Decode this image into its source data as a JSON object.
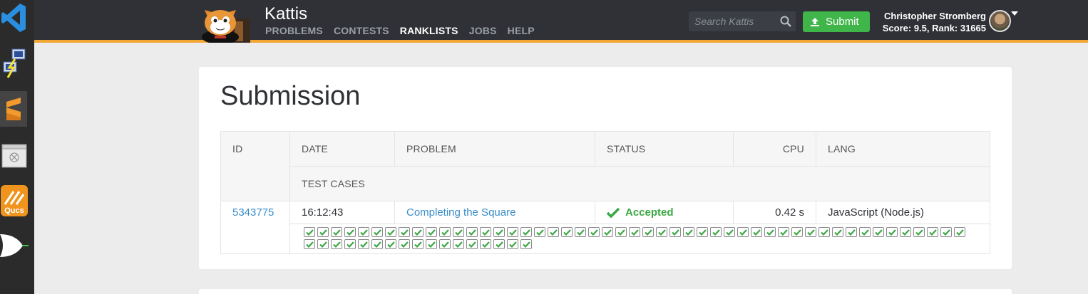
{
  "dock": {
    "icons": [
      "vscode-icon",
      "network-icon",
      "sublime-icon",
      "disk-icon",
      "qucs-icon",
      "logic-gate-icon"
    ],
    "qucs_label": "Qucs"
  },
  "navbar": {
    "brand": "Kattis",
    "links": [
      "PROBLEMS",
      "CONTESTS",
      "RANKLISTS",
      "JOBS",
      "HELP"
    ],
    "active_link": "RANKLISTS",
    "search_placeholder": "Search Kattis",
    "submit_label": "Submit",
    "user_name": "Christopher Stromberg",
    "user_stats": "Score: 9.5, Rank: 31665",
    "accent_color": "#f2a633"
  },
  "main": {
    "title": "Submission",
    "table": {
      "headers": {
        "id": "ID",
        "date": "DATE",
        "problem": "PROBLEM",
        "status": "STATUS",
        "cpu": "CPU",
        "lang": "LANG",
        "test_cases": "TEST CASES"
      },
      "row": {
        "id": "5343775",
        "date": "16:12:43",
        "problem": "Completing the Square",
        "status": "Accepted",
        "cpu": "0.42 s",
        "lang": "JavaScript (Node.js)"
      },
      "test_case_count": 66,
      "test_case_result": "passed",
      "status_color": "#3aa844"
    }
  }
}
